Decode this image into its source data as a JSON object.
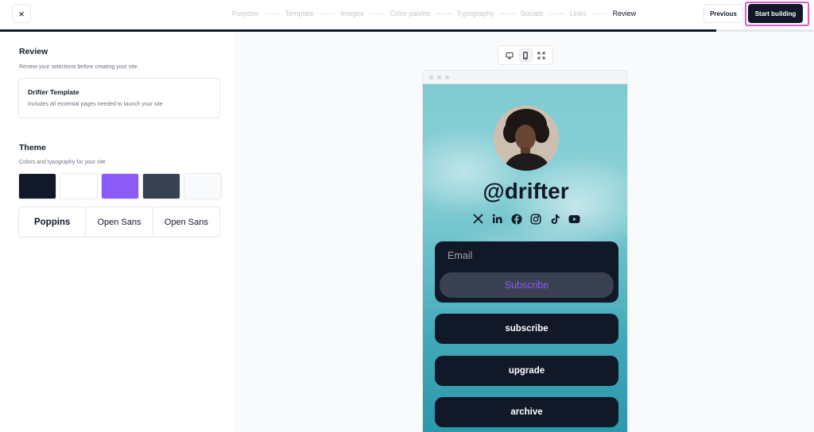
{
  "header": {
    "close_label": "×",
    "steps": [
      {
        "label": "Purpose"
      },
      {
        "label": "Template"
      },
      {
        "label": "Images"
      },
      {
        "label": "Color palette"
      },
      {
        "label": "Typography"
      },
      {
        "label": "Socials"
      },
      {
        "label": "Links"
      },
      {
        "label": "Review"
      }
    ],
    "active_step": "Review",
    "previous_label": "Previous",
    "start_label": "Start building",
    "progress": 0.88
  },
  "review": {
    "title": "Review",
    "subtitle": "Review your selections before creating your site",
    "template_name": "Drifter Template",
    "template_desc": "Includes all essential pages needed to launch your site"
  },
  "theme": {
    "title": "Theme",
    "subtitle": "Colors and typography for your site",
    "colors": [
      "#111827",
      "#ffffff",
      "#8b5cf6",
      "#374151",
      "#f9fafb"
    ],
    "fonts": [
      "Poppins",
      "Open Sans",
      "Open Sans"
    ]
  },
  "preview": {
    "devices": [
      "desktop-icon",
      "mobile-icon",
      "fullscreen-icon"
    ],
    "active_device": "mobile",
    "handle": "@drifter",
    "socials": [
      "x-icon",
      "linkedin-icon",
      "facebook-icon",
      "instagram-icon",
      "tiktok-icon",
      "youtube-icon"
    ],
    "email_placeholder": "Email",
    "subscribe_label": "Subscribe",
    "links": [
      "subscribe",
      "upgrade",
      "archive"
    ]
  }
}
